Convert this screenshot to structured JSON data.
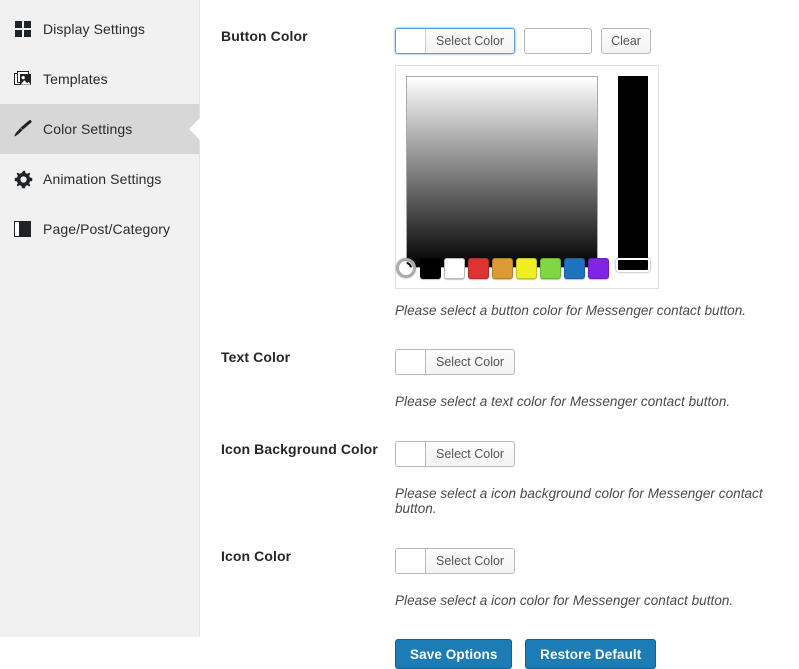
{
  "sidebar": {
    "items": [
      {
        "label": "Display Settings",
        "icon": "grid-icon",
        "active": false
      },
      {
        "label": "Templates",
        "icon": "templates-icon",
        "active": false
      },
      {
        "label": "Color Settings",
        "icon": "brush-icon",
        "active": true
      },
      {
        "label": "Animation Settings",
        "icon": "gear-icon",
        "active": false
      },
      {
        "label": "Page/Post/Category",
        "icon": "pages-icon",
        "active": false
      }
    ]
  },
  "fields": {
    "button_color": {
      "label": "Button Color",
      "select_label": "Select Color",
      "input_value": "",
      "input_placeholder": "",
      "clear_label": "Clear",
      "helper": "Please select a button color for Messenger contact button.",
      "swatch": "#ffffff"
    },
    "text_color": {
      "label": "Text Color",
      "select_label": "Select Color",
      "helper": "Please select a text color for Messenger contact button.",
      "swatch": "#ffffff"
    },
    "icon_background_color": {
      "label": "Icon Background Color",
      "select_label": "Select Color",
      "helper": "Please select a icon background color for Messenger contact button.",
      "swatch": "#ffffff"
    },
    "icon_color": {
      "label": "Icon Color",
      "select_label": "Select Color",
      "helper": "Please select a icon color for Messenger contact button.",
      "swatch": "#ffffff"
    }
  },
  "picker": {
    "current_color": "#000000",
    "strip_color": "#000000",
    "palette": [
      {
        "name": "black",
        "hex": "#000000"
      },
      {
        "name": "white",
        "hex": "#ffffff"
      },
      {
        "name": "red",
        "hex": "#dd3333"
      },
      {
        "name": "orange",
        "hex": "#dd9933"
      },
      {
        "name": "yellow",
        "hex": "#eeee22"
      },
      {
        "name": "green",
        "hex": "#81d742"
      },
      {
        "name": "blue",
        "hex": "#1e73be"
      },
      {
        "name": "purple",
        "hex": "#8224e3"
      }
    ]
  },
  "actions": {
    "save_label": "Save Options",
    "restore_label": "Restore Default",
    "accent": "#1c7cb5"
  }
}
